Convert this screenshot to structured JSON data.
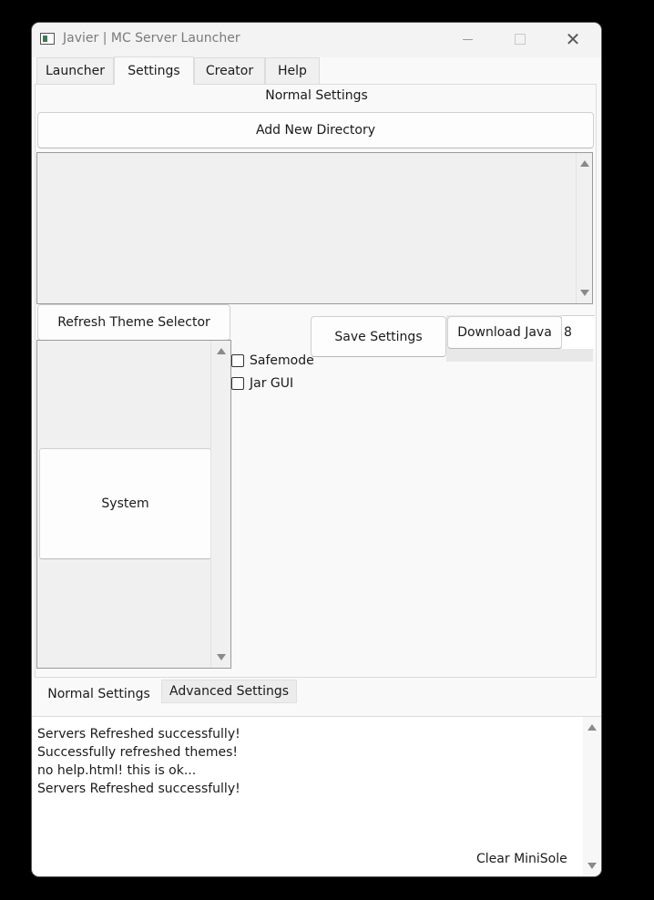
{
  "window": {
    "title": "Javier | MC Server Launcher"
  },
  "tabs": [
    {
      "label": "Launcher"
    },
    {
      "label": "Settings"
    },
    {
      "label": "Creator"
    },
    {
      "label": "Help"
    }
  ],
  "settings": {
    "section_title": "Normal Settings",
    "add_directory_label": "Add New Directory",
    "refresh_theme_label": "Refresh Theme Selector",
    "save_settings_label": "Save Settings",
    "download_java_label": "Download Java",
    "java_version": "8",
    "theme_items": [
      "System"
    ],
    "checkboxes": [
      {
        "label": "Safemode",
        "checked": false
      },
      {
        "label": "Jar GUI",
        "checked": false
      }
    ]
  },
  "subtabs": [
    {
      "label": "Normal Settings"
    },
    {
      "label": "Advanced Settings"
    }
  ],
  "console": {
    "lines": [
      "Servers Refreshed successfully!",
      "Successfully refreshed themes!",
      "no help.html! this is ok...",
      "Servers Refreshed successfully!"
    ],
    "clear_label": "Clear MiniSole"
  }
}
